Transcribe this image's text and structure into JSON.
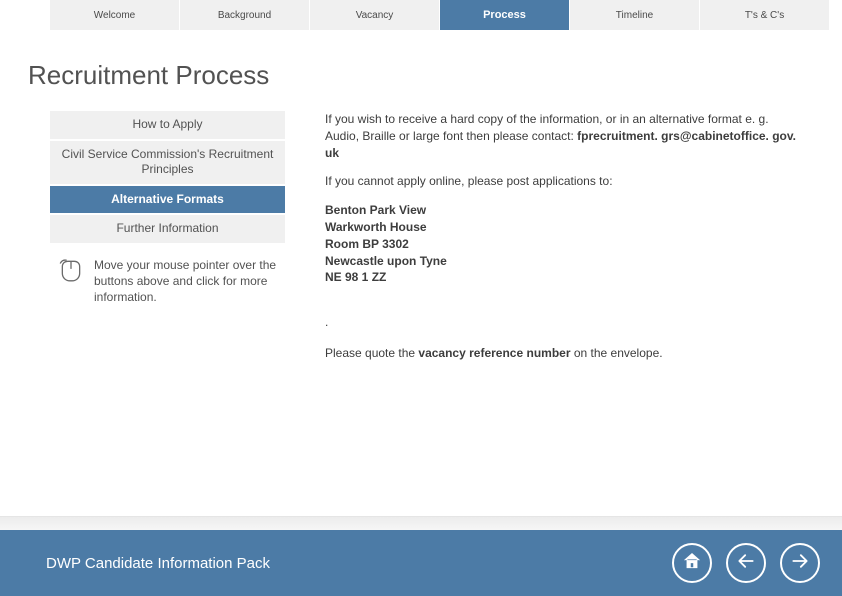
{
  "tabs": {
    "t0": "Welcome",
    "t1": "Background",
    "t2": "Vacancy",
    "t3": "Process",
    "t4": "Timeline",
    "t5": "T's & C's"
  },
  "page_title": "Recruitment Process",
  "sidebar": {
    "s0": "How to Apply",
    "s1": "Civil Service Commission's Recruitment Principles",
    "s2": "Alternative Formats",
    "s3": "Further Information",
    "hint": "Move your mouse pointer over the buttons above and click for more information."
  },
  "main": {
    "intro_a": "If you wish to receive a hard copy of the information, or in an alternative format e. g. Audio, Braille or large font then please contact: ",
    "intro_b": "fprecruitment. grs@cabinetoffice. gov. uk",
    "cannot": "If you cannot apply online, please post applications to:",
    "addr1": "Benton Park View",
    "addr2": "Warkworth House",
    "addr3": "Room BP 3302",
    "addr4": "Newcastle upon Tyne",
    "addr5": "NE 98 1 ZZ",
    "dot": ".",
    "quote_a": "Please quote the ",
    "quote_b": "vacancy reference number",
    "quote_c": " on the envelope."
  },
  "footer": {
    "title": "DWP Candidate Information Pack"
  }
}
